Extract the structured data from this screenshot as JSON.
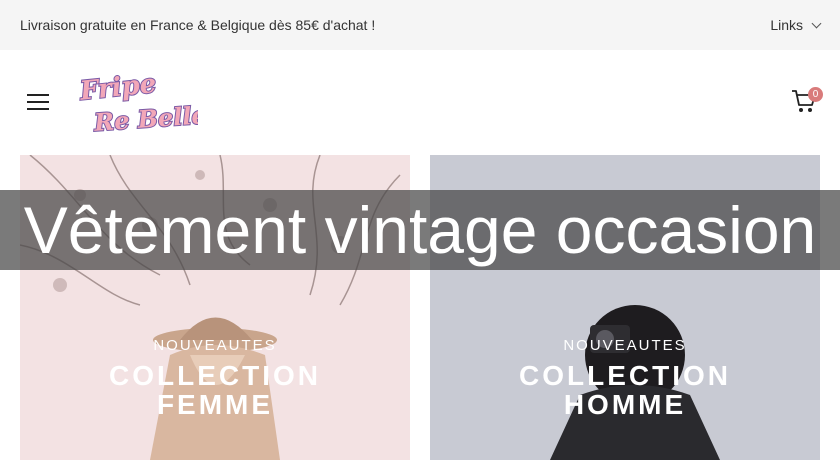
{
  "topbar": {
    "promo": "Livraison gratuite en France & Belgique dès 85€ d'achat !",
    "links_label": "Links"
  },
  "header": {
    "logo_line1": "Fripe",
    "logo_line2": "Re Belle",
    "cart_count": "0"
  },
  "hero": {
    "title": "Vêtement vintage occasion"
  },
  "collections": [
    {
      "overline": "NOUVEAUTES",
      "line1": "COLLECTION",
      "line2": "FEMME"
    },
    {
      "overline": "NOUVEAUTES",
      "line1": "COLLECTION",
      "line2": "HOMME"
    }
  ],
  "colors": {
    "badge": "#d97b7b",
    "logo_purple": "#7a5aa6",
    "logo_pink": "#f2a7b8",
    "hero_overlay": "rgba(70,70,70,0.72)"
  },
  "icons": [
    "menu-icon",
    "cart-icon",
    "chevron-down-icon"
  ]
}
